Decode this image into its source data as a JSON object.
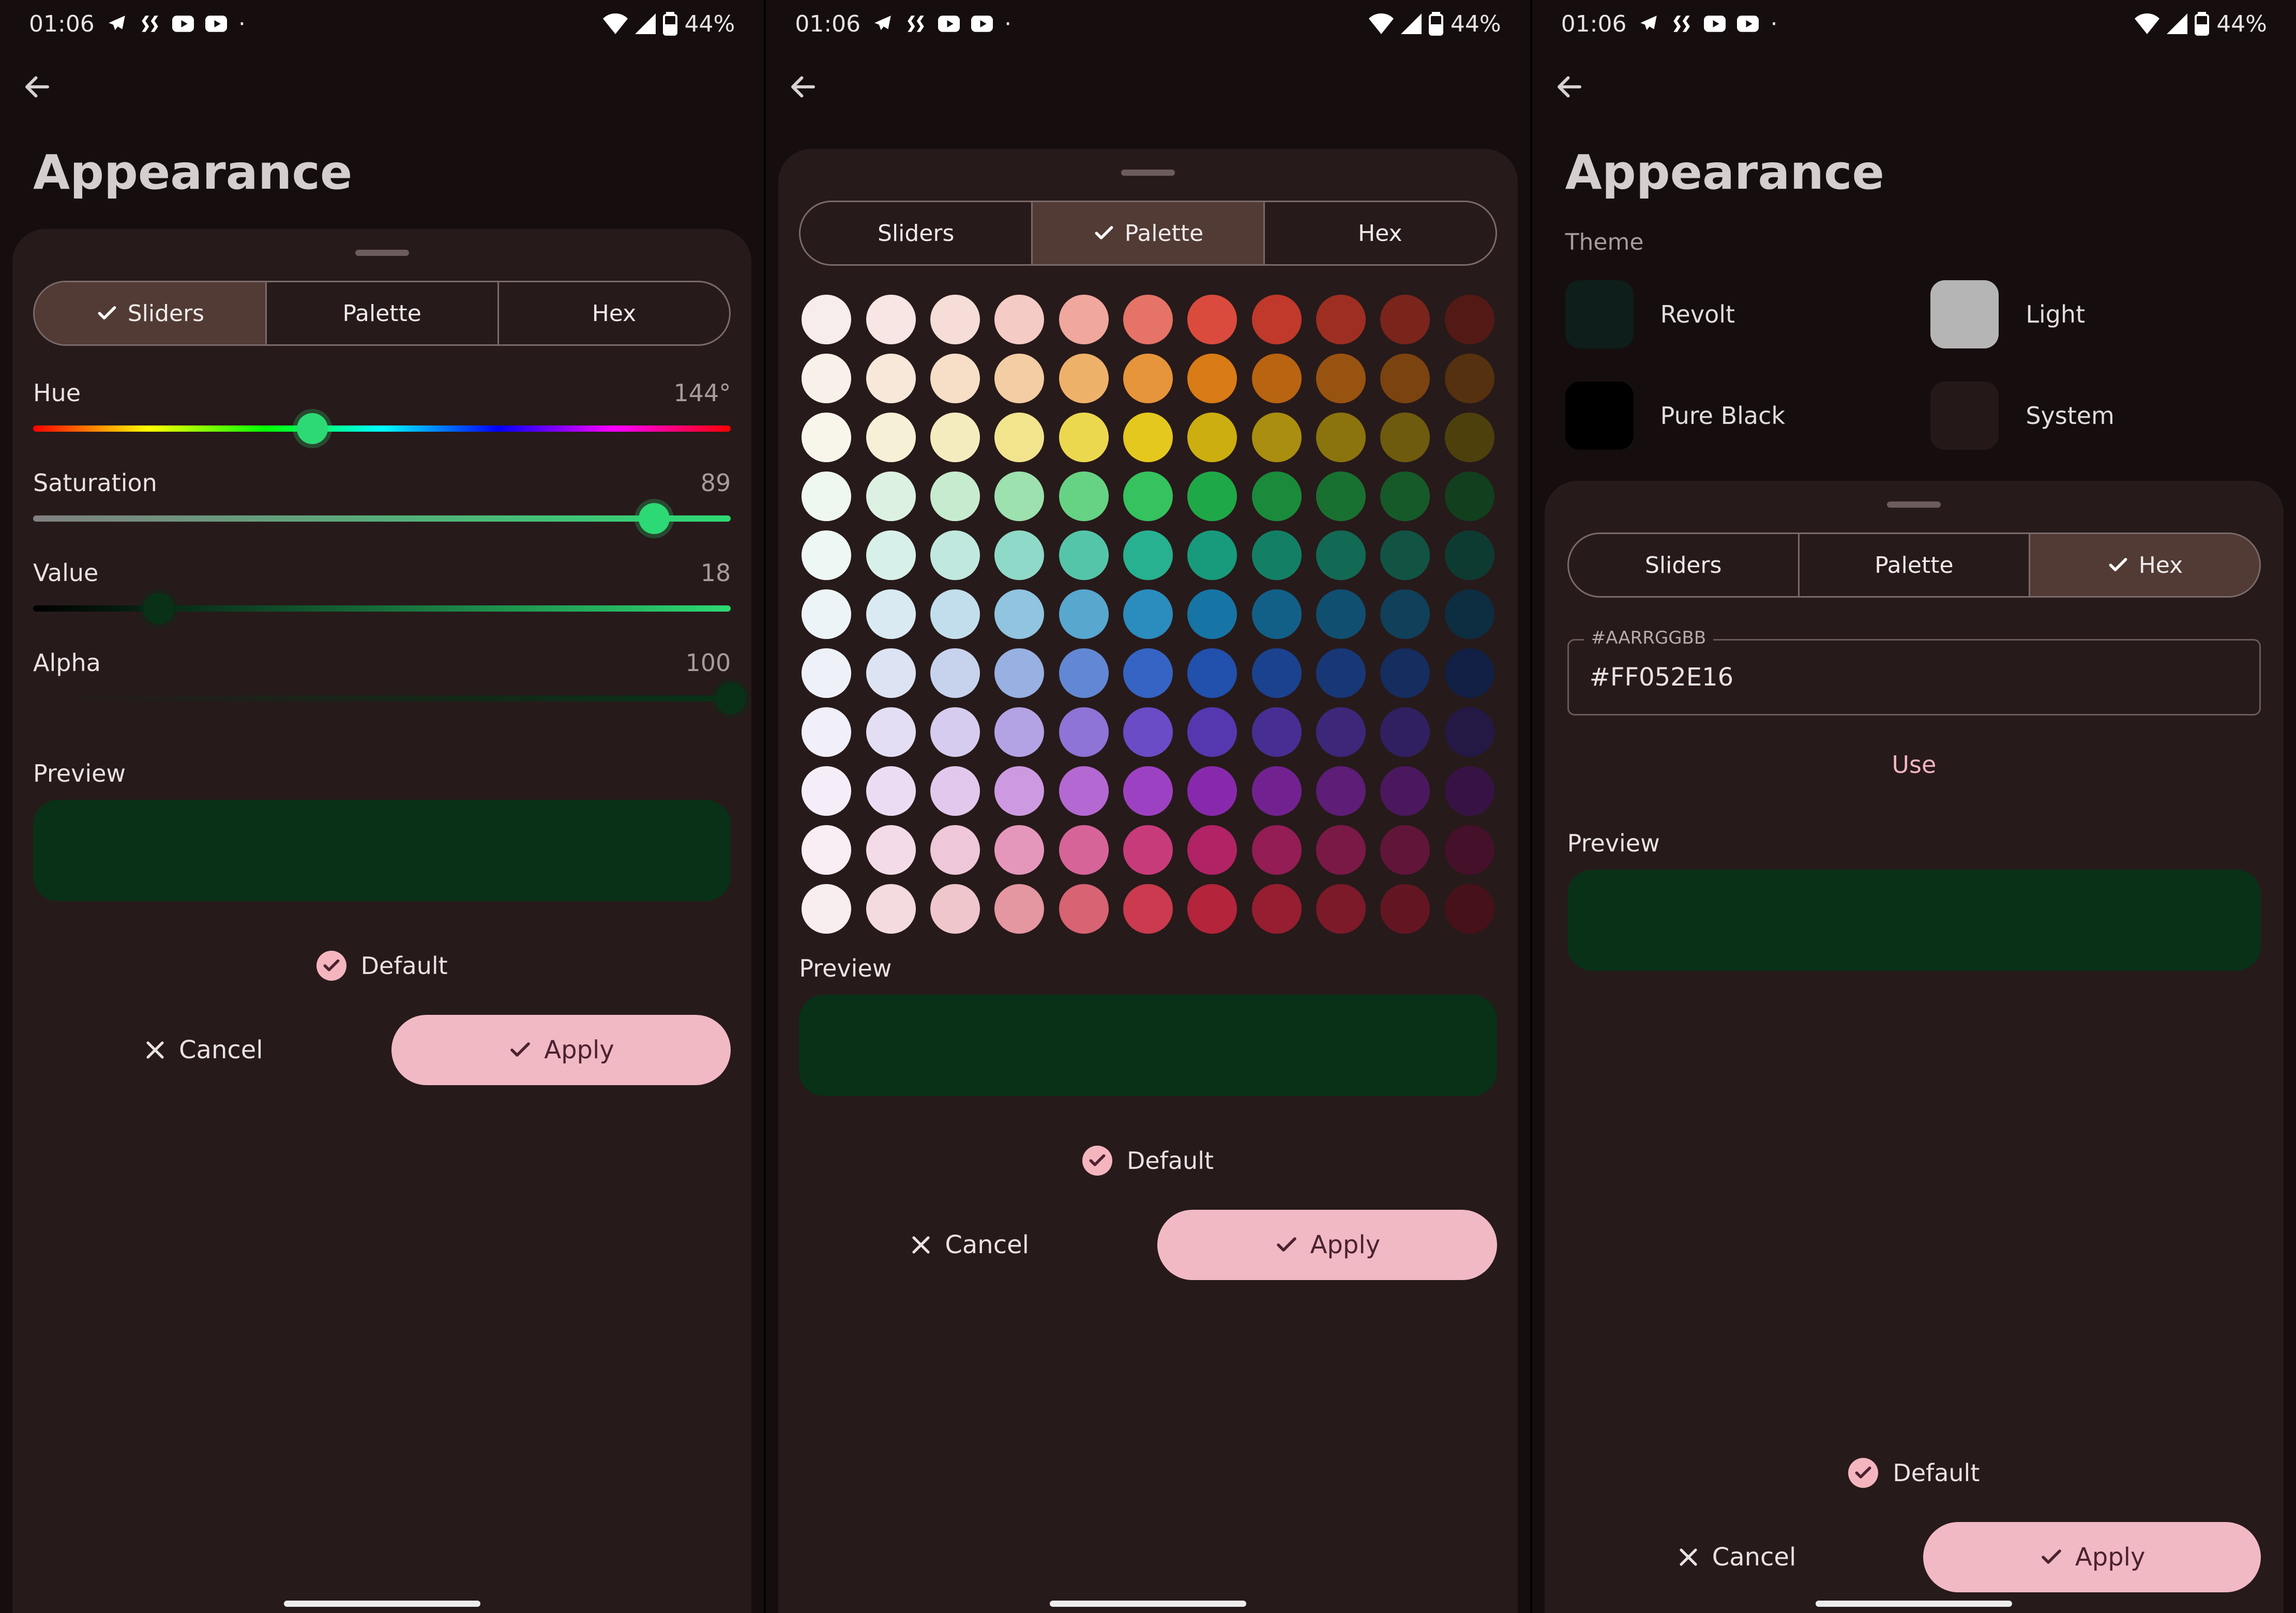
{
  "status": {
    "time": "01:06",
    "battery": "44%",
    "dot": "·"
  },
  "nav": {
    "title": "Appearance"
  },
  "tabs": {
    "sliders": "Sliders",
    "palette": "Palette",
    "hex": "Hex"
  },
  "sliders": {
    "hue_label": "Hue",
    "hue_value": "144°",
    "hue_pct": 40,
    "sat_label": "Saturation",
    "sat_value": "89",
    "sat_pct": 89,
    "val_label": "Value",
    "val_value": "18",
    "val_pct": 18,
    "alpha_label": "Alpha",
    "alpha_value": "100",
    "alpha_pct": 100
  },
  "preview_label": "Preview",
  "preview_color": "#083117",
  "default_label": "Default",
  "cancel_label": "Cancel",
  "apply_label": "Apply",
  "palette": {
    "rows": [
      [
        "#F6EDEC",
        "#F7E6E3",
        "#F7DDD8",
        "#F5CBC5",
        "#EFA79E",
        "#E57368",
        "#DA4B3E",
        "#C0392B",
        "#9E2E22",
        "#7A241C",
        "#531A15"
      ],
      [
        "#F8F1EA",
        "#F7E8DA",
        "#F6DEC7",
        "#F3CDA3",
        "#EDB169",
        "#E6953A",
        "#D97B16",
        "#B96411",
        "#995310",
        "#7A4310",
        "#55310F"
      ],
      [
        "#F8F6EA",
        "#F6F1D6",
        "#F4ECBF",
        "#F1E48D",
        "#ECD84F",
        "#E4C81E",
        "#CCAE11",
        "#AA8E0F",
        "#8B740E",
        "#6E5B0E",
        "#4D400D"
      ],
      [
        "#EEF7F0",
        "#DCF1E1",
        "#C7EBCE",
        "#9CE1AE",
        "#66D384",
        "#35C25F",
        "#1FA848",
        "#1A8A3B",
        "#187131",
        "#165A29",
        "#123F1E"
      ],
      [
        "#EDF7F4",
        "#D8F0EA",
        "#C0E8DE",
        "#8ED9C7",
        "#55C5AA",
        "#27B190",
        "#179B7C",
        "#138066",
        "#126A55",
        "#115444",
        "#0E3B31"
      ],
      [
        "#EDF4F7",
        "#D9EAF2",
        "#C2DEEC",
        "#90C4DF",
        "#57A7CF",
        "#2B8CBE",
        "#1675A5",
        "#126088",
        "#114F71",
        "#10405A",
        "#0D2D40"
      ],
      [
        "#EEF1F8",
        "#DCE3F3",
        "#C7D2ED",
        "#98B0E2",
        "#6287D4",
        "#3564C4",
        "#2150AD",
        "#1B428F",
        "#183777",
        "#152D5F",
        "#112044"
      ],
      [
        "#F1EFF9",
        "#E4DEF4",
        "#D5CCEF",
        "#B4A3E4",
        "#8D74D6",
        "#6A4CC7",
        "#5538B0",
        "#472E92",
        "#3C2779",
        "#312061",
        "#241845"
      ],
      [
        "#F5EEF8",
        "#ECDCF3",
        "#E2C8ED",
        "#CD9AE1",
        "#B468D2",
        "#9D41C3",
        "#8829AD",
        "#712290",
        "#5E1D77",
        "#4B185F",
        "#361344"
      ],
      [
        "#F8EEF3",
        "#F3DCE7",
        "#EEC7D9",
        "#E497BA",
        "#D76498",
        "#C83B7A",
        "#B12365",
        "#931D54",
        "#7A1946",
        "#611539",
        "#451029"
      ],
      [
        "#F8EEF0",
        "#F3DBDF",
        "#EEC6CC",
        "#E496A1",
        "#D86373",
        "#CB3A4E",
        "#B4243A",
        "#961E30",
        "#7C1A29",
        "#631622",
        "#471119"
      ]
    ]
  },
  "theme": {
    "section_label": "Theme",
    "items": [
      {
        "key": "revolt",
        "label": "Revolt"
      },
      {
        "key": "light",
        "label": "Light"
      },
      {
        "key": "black",
        "label": "Pure Black"
      },
      {
        "key": "system",
        "label": "System"
      }
    ]
  },
  "hex": {
    "placeholder": "#AARRGGBB",
    "value": "#FF052E16",
    "use_label": "Use"
  }
}
